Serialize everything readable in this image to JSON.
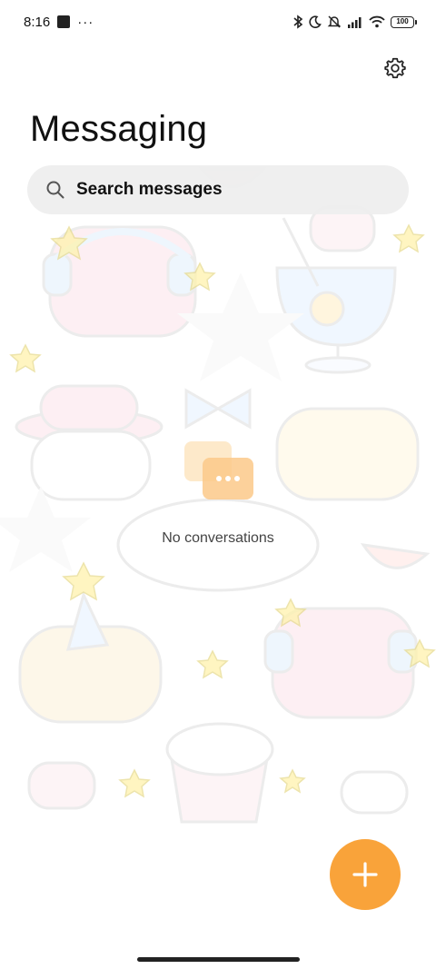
{
  "status_bar": {
    "time": "8:16",
    "battery": "100",
    "icons": [
      "app-notification-icon",
      "more-notifications-icon",
      "bluetooth-icon",
      "dnd-moon-icon",
      "bell-muted-icon",
      "signal-icon",
      "wifi-icon",
      "battery-icon"
    ]
  },
  "header": {
    "title": "Messaging",
    "settings_icon": "gear-icon"
  },
  "search": {
    "placeholder": "Search messages",
    "icon": "search-icon"
  },
  "empty_state": {
    "icon": "chat-bubbles-icon",
    "text": "No conversations"
  },
  "fab": {
    "icon": "plus-icon",
    "color": "#f9a33a"
  },
  "colors": {
    "accent": "#f9a33a",
    "search_bg": "#eeeeee"
  },
  "wallpaper": "pastel-cute-animals-pattern"
}
